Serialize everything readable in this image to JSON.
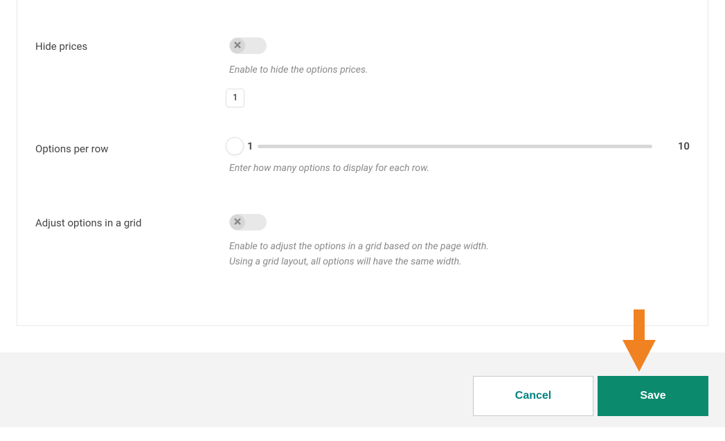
{
  "fields": {
    "hidePrices": {
      "label": "Hide prices",
      "help": "Enable to hide the options prices.",
      "value": false
    },
    "optionsPerRow": {
      "label": "Options per row",
      "help": "Enter how many options to display for each row.",
      "value": 1,
      "min": 1,
      "max": 10
    },
    "adjustGrid": {
      "label": "Adjust options in a grid",
      "help1": "Enable to adjust the options in a grid based on the page width.",
      "help2": "Using a grid layout, all options will have the same width.",
      "value": false
    }
  },
  "footer": {
    "cancel": "Cancel",
    "save": "Save"
  },
  "colors": {
    "primary": "#0b8a6e",
    "cancelText": "#008080",
    "arrow": "#f08222"
  }
}
